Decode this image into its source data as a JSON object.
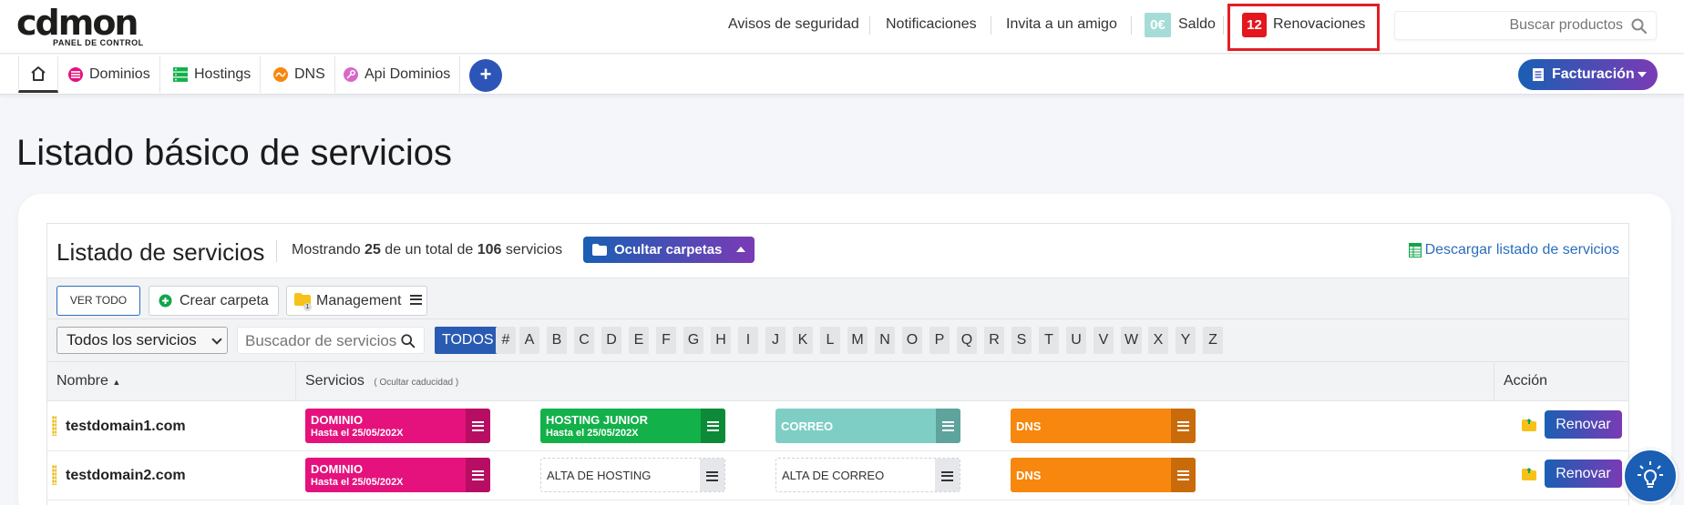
{
  "logo": {
    "word": "cdmon",
    "subtitle": "PANEL DE CONTROL"
  },
  "topbar": {
    "avisos": "Avisos de seguridad",
    "notificaciones": "Notificaciones",
    "invita": "Invita a un amigo",
    "saldo_amount": "0€",
    "saldo_label": "Saldo",
    "renovaciones_count": "12",
    "renovaciones_label": "Renovaciones",
    "search_placeholder": "Buscar productos"
  },
  "nav": {
    "items": [
      {
        "label": "Dominios"
      },
      {
        "label": "Hostings"
      },
      {
        "label": "DNS"
      },
      {
        "label": "Api Dominios"
      }
    ],
    "plus": "+",
    "facturacion": "Facturación"
  },
  "page": {
    "title": "Listado básico de servicios"
  },
  "panel": {
    "title": "Listado de servicios",
    "mostrando_pre": "Mostrando",
    "shown": "25",
    "mostrando_mid": "de un total de",
    "total": "106",
    "mostrando_post": "servicios",
    "ocultar": "Ocultar carpetas",
    "descargar": "Descargar listado de servicios"
  },
  "folders": {
    "ver_todo": "VER TODO",
    "crear": "Crear carpeta",
    "management": "Management",
    "management_count": "1"
  },
  "filters": {
    "select_value": "Todos los servicios",
    "search_placeholder": "Buscador de servicios",
    "letters": [
      "TODOS",
      "#",
      "A",
      "B",
      "C",
      "D",
      "E",
      "F",
      "G",
      "H",
      "I",
      "J",
      "K",
      "L",
      "M",
      "N",
      "O",
      "P",
      "Q",
      "R",
      "S",
      "T",
      "U",
      "V",
      "W",
      "X",
      "Y",
      "Z"
    ]
  },
  "table": {
    "col_nombre": "Nombre",
    "col_servicios": "Servicios",
    "col_servicios_note": "( Ocultar caducidad )",
    "col_accion": "Acción",
    "rows": [
      {
        "name": "testdomain1.com",
        "services": [
          {
            "label": "DOMINIO",
            "sub": "Hasta el 25/05/202X"
          },
          {
            "label": "HOSTING JUNIOR",
            "sub": "Hasta el 25/05/202X"
          },
          {
            "label": "CORREO",
            "sub": ""
          },
          {
            "label": "DNS",
            "sub": ""
          }
        ],
        "action": "Renovar"
      },
      {
        "name": "testdomain2.com",
        "services": [
          {
            "label": "DOMINIO",
            "sub": "Hasta el 25/05/202X"
          },
          {
            "label": "ALTA DE HOSTING",
            "sub": ""
          },
          {
            "label": "ALTA DE CORREO",
            "sub": ""
          },
          {
            "label": "DNS",
            "sub": ""
          }
        ],
        "action": "Renovar"
      }
    ]
  },
  "colors": {
    "dominio": "#e5127d",
    "hosting": "#12b14a",
    "correo": "#7fcec6",
    "dns": "#f7870f",
    "accent_blue": "#1a5fb4",
    "accent_purple": "#7a3bb5",
    "alert_red": "#e3171d"
  },
  "icons": [
    "home-icon",
    "dominios-icon",
    "hostings-icon",
    "dns-icon",
    "api-icon",
    "search-icon",
    "folder-icon",
    "add-circle-icon",
    "spreadsheet-icon",
    "menu-icon",
    "lightbulb-icon"
  ]
}
